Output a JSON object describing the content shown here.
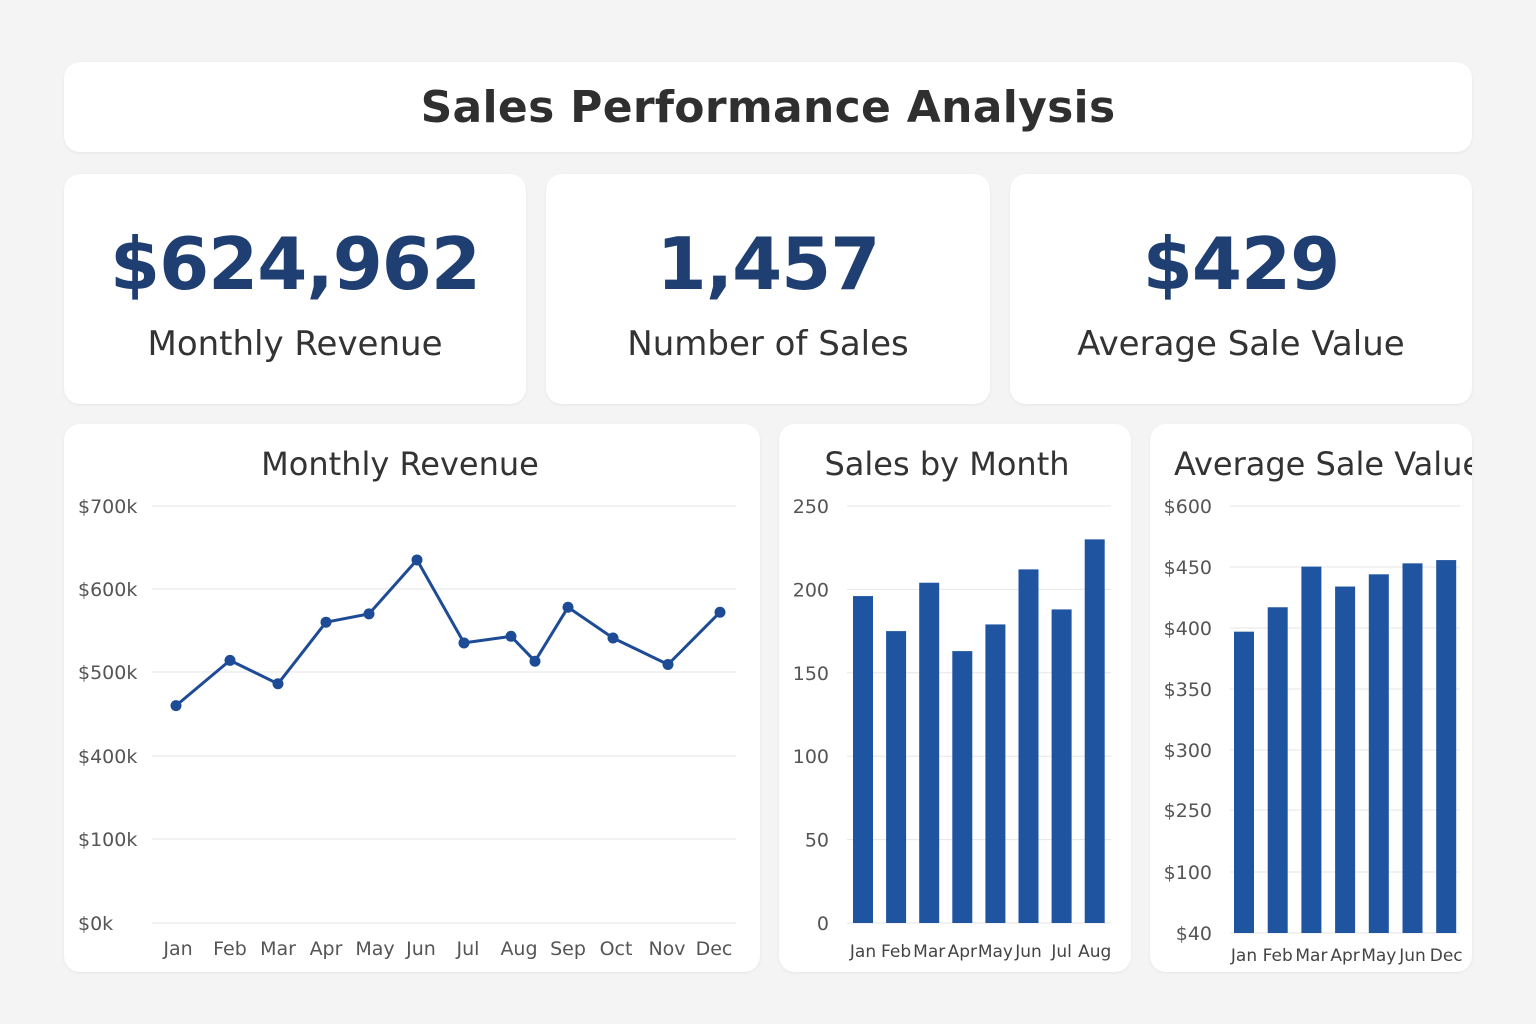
{
  "title": "Sales Performance Analysis",
  "colors": {
    "accent": "#1f3f73",
    "series": "#1f55a0",
    "line": "#1d4b95"
  },
  "kpis": [
    {
      "value": "$624,962",
      "label": "Monthly Revenue"
    },
    {
      "value": "1,457",
      "label": "Number of Sales"
    },
    {
      "value": "$429",
      "label": "Average Sale Value"
    }
  ],
  "chart_data": [
    {
      "type": "line",
      "title": "Monthly Revenue",
      "categories": [
        "Jan",
        "Feb",
        "Mar",
        "Apr",
        "May",
        "Jun",
        "Jul",
        "Aug",
        "Aug",
        "Sep",
        "Oct",
        "Nov",
        "Dec"
      ],
      "tick_labels": [
        "Jan",
        "Feb",
        "Mar",
        "Apr",
        "May",
        "Jun",
        "Jul",
        "Aug",
        "Sep",
        "Oct",
        "Nov",
        "Dec"
      ],
      "y_ticks": [
        "$0k",
        "$100k",
        "$400k",
        "$500k",
        "$600k",
        "$700k"
      ],
      "y_tick_values": [
        0,
        100,
        400,
        500,
        600,
        700
      ],
      "values": [
        460,
        514,
        486,
        560,
        570,
        635,
        535,
        543,
        513,
        578,
        541,
        509,
        572
      ],
      "ylabel": "",
      "xlabel": "",
      "grid": true
    },
    {
      "type": "bar",
      "title": "Sales by Month",
      "categories": [
        "Jan",
        "Feb",
        "Mar",
        "Apr",
        "May",
        "Jun",
        "Jul",
        "Aug"
      ],
      "values": [
        196,
        175,
        204,
        163,
        179,
        212,
        188,
        230
      ],
      "y_ticks": [
        "0",
        "50",
        "100",
        "150",
        "200",
        "250"
      ],
      "y_tick_values": [
        0,
        50,
        100,
        150,
        200,
        250
      ],
      "ylim": [
        0,
        250
      ],
      "grid": true
    },
    {
      "type": "bar",
      "title": "Average Sale Value",
      "categories": [
        "Jan",
        "Feb",
        "Mar",
        "Apr",
        "May",
        "Jun",
        "Dec"
      ],
      "values": [
        397,
        417,
        451,
        434,
        444,
        459,
        467
      ],
      "y_ticks": [
        "$40",
        "$100",
        "$250",
        "$300",
        "$350",
        "$400",
        "$450",
        "$600"
      ],
      "y_tick_values": [
        40,
        100,
        250,
        300,
        350,
        400,
        450,
        600
      ],
      "grid": true
    }
  ]
}
